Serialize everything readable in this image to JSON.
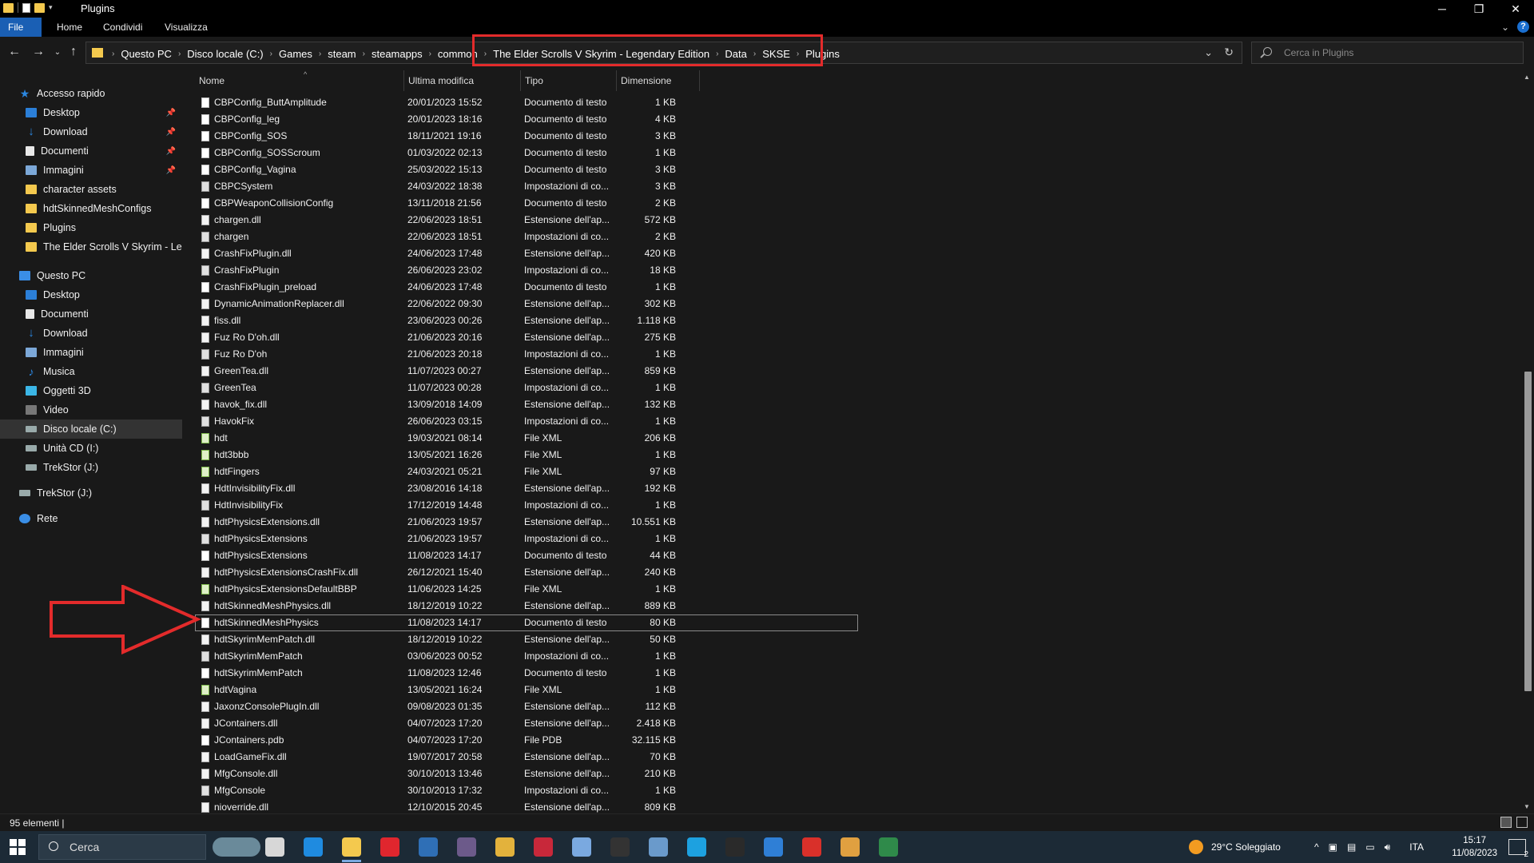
{
  "window": {
    "title": "Plugins",
    "minimize": "─",
    "maximize": "❐",
    "close": "✕"
  },
  "ribbon": {
    "tabs": [
      "File",
      "Home",
      "Condividi",
      "Visualizza"
    ],
    "expand": "⌄",
    "help": "?"
  },
  "address": {
    "crumbs": [
      "Questo PC",
      "Disco locale (C:)",
      "Games",
      "steam",
      "steamapps",
      "common",
      "The Elder Scrolls V Skyrim - Legendary Edition",
      "Data",
      "SKSE",
      "Plugins"
    ],
    "search_placeholder": "Cerca in Plugins"
  },
  "nav": {
    "items": [
      {
        "label": "Accesso rapido",
        "icon": "star-icon",
        "pinned": false
      },
      {
        "label": "Desktop",
        "icon": "desktop-icon",
        "pinned": true
      },
      {
        "label": "Download",
        "icon": "download-icon",
        "pinned": true
      },
      {
        "label": "Documenti",
        "icon": "documents-icon",
        "pinned": true
      },
      {
        "label": "Immagini",
        "icon": "pictures-icon",
        "pinned": true
      },
      {
        "label": "character assets",
        "icon": "folder-icon",
        "pinned": false
      },
      {
        "label": "hdtSkinnedMeshConfigs",
        "icon": "folder-icon",
        "pinned": false
      },
      {
        "label": "Plugins",
        "icon": "folder-icon",
        "pinned": false
      },
      {
        "label": "The Elder Scrolls V Skyrim - Leger",
        "icon": "folder-icon",
        "pinned": false
      },
      {
        "label": "Questo PC",
        "icon": "pc-icon",
        "pinned": false
      },
      {
        "label": "Desktop",
        "icon": "desktop-icon",
        "pinned": false
      },
      {
        "label": "Documenti",
        "icon": "documents-icon",
        "pinned": false
      },
      {
        "label": "Download",
        "icon": "download-icon",
        "pinned": false
      },
      {
        "label": "Immagini",
        "icon": "pictures-icon",
        "pinned": false
      },
      {
        "label": "Musica",
        "icon": "music-icon",
        "pinned": false
      },
      {
        "label": "Oggetti 3D",
        "icon": "objects-3d-icon",
        "pinned": false
      },
      {
        "label": "Video",
        "icon": "video-icon",
        "pinned": false
      },
      {
        "label": "Disco locale (C:)",
        "icon": "drive-icon",
        "pinned": false
      },
      {
        "label": "Unità CD (I:)",
        "icon": "drive-icon",
        "pinned": false
      },
      {
        "label": "TrekStor (J:)",
        "icon": "drive-icon",
        "pinned": false
      },
      {
        "label": "TrekStor (J:)",
        "icon": "drive-icon",
        "pinned": false
      },
      {
        "label": "Rete",
        "icon": "network-icon",
        "pinned": false
      }
    ]
  },
  "columns": {
    "name": "Nome",
    "modified": "Ultima modifica",
    "type": "Tipo",
    "size": "Dimensione"
  },
  "files": [
    {
      "name": "CBPConfig_ButtAmplitude",
      "date": "20/01/2023 15:52",
      "type": "Documento di testo",
      "size": "1 KB",
      "kind": "txt"
    },
    {
      "name": "CBPConfig_leg",
      "date": "20/01/2023 18:16",
      "type": "Documento di testo",
      "size": "4 KB",
      "kind": "txt"
    },
    {
      "name": "CBPConfig_SOS",
      "date": "18/11/2021 19:16",
      "type": "Documento di testo",
      "size": "3 KB",
      "kind": "txt"
    },
    {
      "name": "CBPConfig_SOSScroum",
      "date": "01/03/2022 02:13",
      "type": "Documento di testo",
      "size": "1 KB",
      "kind": "txt"
    },
    {
      "name": "CBPConfig_Vagina",
      "date": "25/03/2022 15:13",
      "type": "Documento di testo",
      "size": "3 KB",
      "kind": "txt"
    },
    {
      "name": "CBPCSystem",
      "date": "24/03/2022 18:38",
      "type": "Impostazioni di co...",
      "size": "3 KB",
      "kind": "cfg"
    },
    {
      "name": "CBPWeaponCollisionConfig",
      "date": "13/11/2018 21:56",
      "type": "Documento di testo",
      "size": "2 KB",
      "kind": "txt"
    },
    {
      "name": "chargen.dll",
      "date": "22/06/2023 18:51",
      "type": "Estensione dell'ap...",
      "size": "572 KB",
      "kind": "dll"
    },
    {
      "name": "chargen",
      "date": "22/06/2023 18:51",
      "type": "Impostazioni di co...",
      "size": "2 KB",
      "kind": "cfg"
    },
    {
      "name": "CrashFixPlugin.dll",
      "date": "24/06/2023 17:48",
      "type": "Estensione dell'ap...",
      "size": "420 KB",
      "kind": "dll"
    },
    {
      "name": "CrashFixPlugin",
      "date": "26/06/2023 23:02",
      "type": "Impostazioni di co...",
      "size": "18 KB",
      "kind": "cfg"
    },
    {
      "name": "CrashFixPlugin_preload",
      "date": "24/06/2023 17:48",
      "type": "Documento di testo",
      "size": "1 KB",
      "kind": "txt"
    },
    {
      "name": "DynamicAnimationReplacer.dll",
      "date": "22/06/2022 09:30",
      "type": "Estensione dell'ap...",
      "size": "302 KB",
      "kind": "dll"
    },
    {
      "name": "fiss.dll",
      "date": "23/06/2023 00:26",
      "type": "Estensione dell'ap...",
      "size": "1.118 KB",
      "kind": "dll"
    },
    {
      "name": "Fuz Ro D'oh.dll",
      "date": "21/06/2023 20:16",
      "type": "Estensione dell'ap...",
      "size": "275 KB",
      "kind": "dll"
    },
    {
      "name": "Fuz Ro D'oh",
      "date": "21/06/2023 20:18",
      "type": "Impostazioni di co...",
      "size": "1 KB",
      "kind": "cfg"
    },
    {
      "name": "GreenTea.dll",
      "date": "11/07/2023 00:27",
      "type": "Estensione dell'ap...",
      "size": "859 KB",
      "kind": "dll"
    },
    {
      "name": "GreenTea",
      "date": "11/07/2023 00:28",
      "type": "Impostazioni di co...",
      "size": "1 KB",
      "kind": "cfg"
    },
    {
      "name": "havok_fix.dll",
      "date": "13/09/2018 14:09",
      "type": "Estensione dell'ap...",
      "size": "132 KB",
      "kind": "dll"
    },
    {
      "name": "HavokFix",
      "date": "26/06/2023 03:15",
      "type": "Impostazioni di co...",
      "size": "1 KB",
      "kind": "cfg"
    },
    {
      "name": "hdt",
      "date": "19/03/2021 08:14",
      "type": "File XML",
      "size": "206 KB",
      "kind": "xml"
    },
    {
      "name": "hdt3bbb",
      "date": "13/05/2021 16:26",
      "type": "File XML",
      "size": "1 KB",
      "kind": "xml"
    },
    {
      "name": "hdtFingers",
      "date": "24/03/2021 05:21",
      "type": "File XML",
      "size": "97 KB",
      "kind": "xml"
    },
    {
      "name": "HdtInvisibilityFix.dll",
      "date": "23/08/2016 14:18",
      "type": "Estensione dell'ap...",
      "size": "192 KB",
      "kind": "dll"
    },
    {
      "name": "HdtInvisibilityFix",
      "date": "17/12/2019 14:48",
      "type": "Impostazioni di co...",
      "size": "1 KB",
      "kind": "cfg"
    },
    {
      "name": "hdtPhysicsExtensions.dll",
      "date": "21/06/2023 19:57",
      "type": "Estensione dell'ap...",
      "size": "10.551 KB",
      "kind": "dll"
    },
    {
      "name": "hdtPhysicsExtensions",
      "date": "21/06/2023 19:57",
      "type": "Impostazioni di co...",
      "size": "1 KB",
      "kind": "cfg"
    },
    {
      "name": "hdtPhysicsExtensions",
      "date": "11/08/2023 14:17",
      "type": "Documento di testo",
      "size": "44 KB",
      "kind": "txt"
    },
    {
      "name": "hdtPhysicsExtensionsCrashFix.dll",
      "date": "26/12/2021 15:40",
      "type": "Estensione dell'ap...",
      "size": "240 KB",
      "kind": "dll"
    },
    {
      "name": "hdtPhysicsExtensionsDefaultBBP",
      "date": "11/06/2023 14:25",
      "type": "File XML",
      "size": "1 KB",
      "kind": "xml"
    },
    {
      "name": "hdtSkinnedMeshPhysics.dll",
      "date": "18/12/2019 10:22",
      "type": "Estensione dell'ap...",
      "size": "889 KB",
      "kind": "dll"
    },
    {
      "name": "hdtSkinnedMeshPhysics",
      "date": "11/08/2023 14:17",
      "type": "Documento di testo",
      "size": "80 KB",
      "kind": "txt",
      "selected": true
    },
    {
      "name": "hdtSkyrimMemPatch.dll",
      "date": "18/12/2019 10:22",
      "type": "Estensione dell'ap...",
      "size": "50 KB",
      "kind": "dll"
    },
    {
      "name": "hdtSkyrimMemPatch",
      "date": "03/06/2023 00:52",
      "type": "Impostazioni di co...",
      "size": "1 KB",
      "kind": "cfg"
    },
    {
      "name": "hdtSkyrimMemPatch",
      "date": "11/08/2023 12:46",
      "type": "Documento di testo",
      "size": "1 KB",
      "kind": "txt"
    },
    {
      "name": "hdtVagina",
      "date": "13/05/2021 16:24",
      "type": "File XML",
      "size": "1 KB",
      "kind": "xml"
    },
    {
      "name": "JaxonzConsolePlugIn.dll",
      "date": "09/08/2023 01:35",
      "type": "Estensione dell'ap...",
      "size": "112 KB",
      "kind": "dll"
    },
    {
      "name": "JContainers.dll",
      "date": "04/07/2023 17:20",
      "type": "Estensione dell'ap...",
      "size": "2.418 KB",
      "kind": "dll"
    },
    {
      "name": "JContainers.pdb",
      "date": "04/07/2023 17:20",
      "type": "File PDB",
      "size": "32.115 KB",
      "kind": "txt"
    },
    {
      "name": "LoadGameFix.dll",
      "date": "19/07/2017 20:58",
      "type": "Estensione dell'ap...",
      "size": "70 KB",
      "kind": "dll"
    },
    {
      "name": "MfgConsole.dll",
      "date": "30/10/2013 13:46",
      "type": "Estensione dell'ap...",
      "size": "210 KB",
      "kind": "dll"
    },
    {
      "name": "MfgConsole",
      "date": "30/10/2013 17:32",
      "type": "Impostazioni di co...",
      "size": "1 KB",
      "kind": "cfg"
    },
    {
      "name": "nioverride.dll",
      "date": "12/10/2015 20:45",
      "type": "Estensione dell'ap...",
      "size": "809 KB",
      "kind": "dll"
    }
  ],
  "status": {
    "count": "95 elementi",
    "separator": "|"
  },
  "taskbar": {
    "search_label": "Cerca",
    "weather": "29°C  Soleggiato",
    "lang": "ITA",
    "time": "15:17",
    "date": "11/08/2023",
    "notifications": "2",
    "tray_overflow": "^",
    "apps": [
      "widgets-icon",
      "task-view-icon",
      "edge-icon",
      "file-explorer-icon",
      "opera-icon",
      "store-icon",
      "archive-icon",
      "notes-icon",
      "game-app-icon",
      "pen-app-icon",
      "skyrim-app-icon",
      "tools-app-icon",
      "skype-icon",
      "msi-icon",
      "window-app-icon",
      "foxit-icon",
      "chevron-app-icon",
      "excel-app-icon"
    ],
    "colors": {
      "accent": "#1a5fb4",
      "highlight_red": "#e32b2b"
    }
  }
}
